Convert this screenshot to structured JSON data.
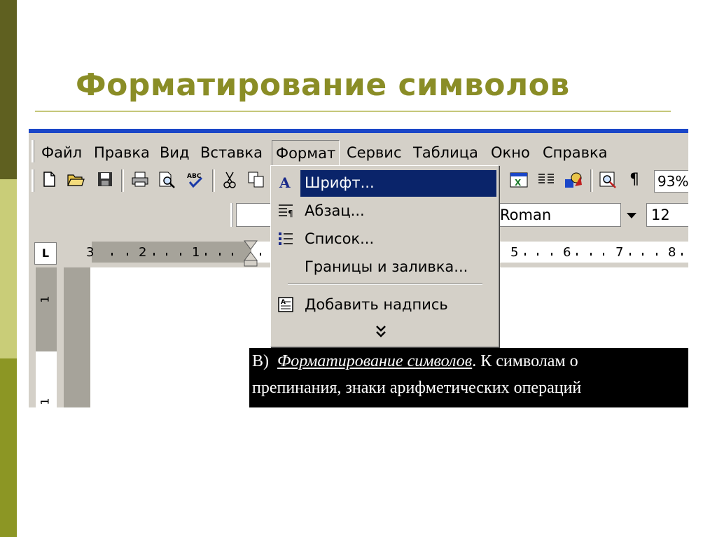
{
  "slide": {
    "title": "Форматирование символов"
  },
  "menubar": {
    "items": [
      "Файл",
      "Правка",
      "Вид",
      "Вставка",
      "Формат",
      "Сервис",
      "Таблица",
      "Окно",
      "Справка"
    ],
    "active": "Формат"
  },
  "toolbar": {
    "zoom": "93%"
  },
  "formatbar": {
    "font_name": "Roman",
    "font_size": "12"
  },
  "ruler": {
    "numbers_left": [
      "3",
      "2",
      "1"
    ],
    "numbers_right": [
      "5",
      "6",
      "7",
      "8"
    ],
    "corner": "L"
  },
  "vruler": {
    "numbers": [
      "1",
      "1"
    ]
  },
  "format_menu": {
    "items": [
      {
        "label": "Шрифт...",
        "icon": "font-a-icon",
        "highlighted": true
      },
      {
        "label": "Абзац...",
        "icon": "paragraph-icon",
        "highlighted": false
      },
      {
        "label": "Список...",
        "icon": "list-icon",
        "highlighted": false
      },
      {
        "label": "Границы и заливка...",
        "icon": "",
        "highlighted": false
      },
      {
        "label": "Добавить надпись",
        "icon": "textbox-icon",
        "highlighted": false
      }
    ],
    "more": "expand-chevron-icon"
  },
  "document": {
    "line1_prefix": "В)",
    "line1_italic": "Форматирование символов",
    "line1_rest": ". К символам о",
    "line2": "препинания, знаки арифметических операций"
  },
  "colors": {
    "title": "#8a8d26",
    "highlight": "#0a246a",
    "window_face": "#d4d0c8",
    "titlebar_blue": "#1a46c8"
  }
}
